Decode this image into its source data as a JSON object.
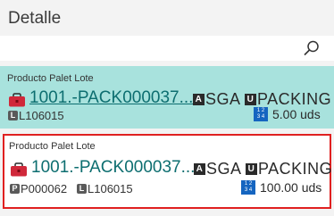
{
  "header": {
    "title": "Detalle"
  },
  "search": {
    "value": "",
    "placeholder": ""
  },
  "items": [
    {
      "type_label": "Producto Palet Lote",
      "code": "1001.-PACK000037...",
      "tag_sga_letter": "A",
      "tag_sga": "SGA",
      "tag_packing_letter": "U",
      "tag_packing": "PACKING",
      "lot_letter": "L",
      "lot": "L106015",
      "quantity": "5.00 uds",
      "selected": false,
      "background": "#a8e2dd"
    },
    {
      "type_label": "Producto Palet Lote",
      "code": "1001.-PACK000037...",
      "tag_sga_letter": "A",
      "tag_sga": "SGA",
      "tag_packing_letter": "U",
      "tag_packing": "PACKING",
      "pallet_letter": "P",
      "pallet": "P000062",
      "lot_letter": "L",
      "lot": "L106015",
      "quantity": "100.00 uds",
      "selected": true,
      "border_color": "#e02020"
    }
  ],
  "icons": {
    "search": "search-icon",
    "product": "bag-icon",
    "quantity": "quantity-icon"
  },
  "colors": {
    "link": "#0d6e70",
    "highlight_bg": "#a8e2dd",
    "selected_border": "#e02020",
    "bag": "#d0283a"
  }
}
